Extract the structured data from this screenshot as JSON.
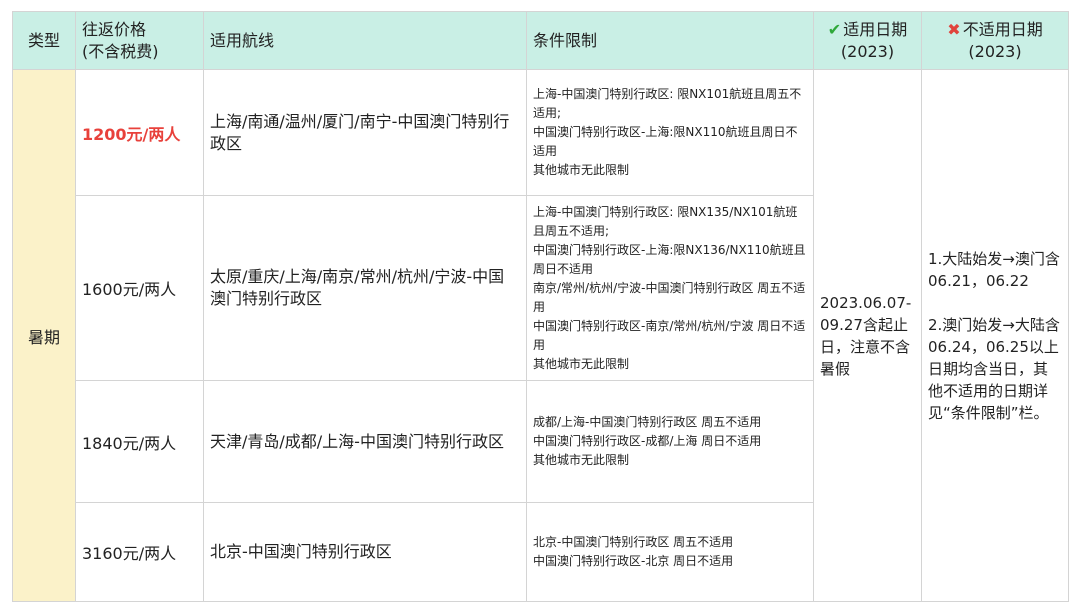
{
  "header": {
    "type": "类型",
    "price_line1": "往返价格",
    "price_line2": "(不含税费)",
    "route": "适用航线",
    "conditions": "条件限制",
    "applicable_line1": "适用日期",
    "applicable_line2": "(2023)",
    "not_applicable_line1": "不适用日期",
    "not_applicable_line2": "(2023)",
    "check_icon": "✔",
    "cross_icon": "✖"
  },
  "season": "暑期",
  "rows": [
    {
      "price": "1200元/两人",
      "route": "上海/南通/温州/厦门/南宁-中国澳门特别行政区",
      "conditions": [
        "上海-中国澳门特别行政区: 限NX101航班且周五不适用;",
        "中国澳门特别行政区-上海:限NX110航班且周日不适用",
        "其他城市无此限制"
      ]
    },
    {
      "price": "1600元/两人",
      "route": "太原/重庆/上海/南京/常州/杭州/宁波-中国澳门特别行政区",
      "conditions": [
        "上海-中国澳门特别行政区: 限NX135/NX101航班且周五不适用;",
        "中国澳门特别行政区-上海:限NX136/NX110航班且周日不适用",
        "南京/常州/杭州/宁波-中国澳门特别行政区 周五不适用",
        "中国澳门特别行政区-南京/常州/杭州/宁波 周日不适用",
        "其他城市无此限制"
      ]
    },
    {
      "price": "1840元/两人",
      "route": "天津/青岛/成都/上海-中国澳门特别行政区",
      "conditions": [
        "成都/上海-中国澳门特别行政区 周五不适用",
        "中国澳门特别行政区-成都/上海 周日不适用",
        "其他城市无此限制"
      ]
    },
    {
      "price": "3160元/两人",
      "route": "北京-中国澳门特别行政区",
      "conditions": [
        "北京-中国澳门特别行政区 周五不适用",
        "中国澳门特别行政区-北京 周日不适用"
      ]
    }
  ],
  "applicable_dates": "2023.06.07-09.27含起止日，注意不含暑假",
  "not_applicable": {
    "part1": "1.大陆始发→澳门含06.21，06.22",
    "part2": "2.澳门始发→大陆含06.24，06.25以上日期均含当日，其他不适用的日期详见“条件限制”栏。"
  },
  "colors": {
    "header_bg": "#c9efe5",
    "type_bg": "#fbf2c9",
    "highlight_price": "#e8413b",
    "check": "#2ea83a",
    "cross": "#e0443c"
  }
}
